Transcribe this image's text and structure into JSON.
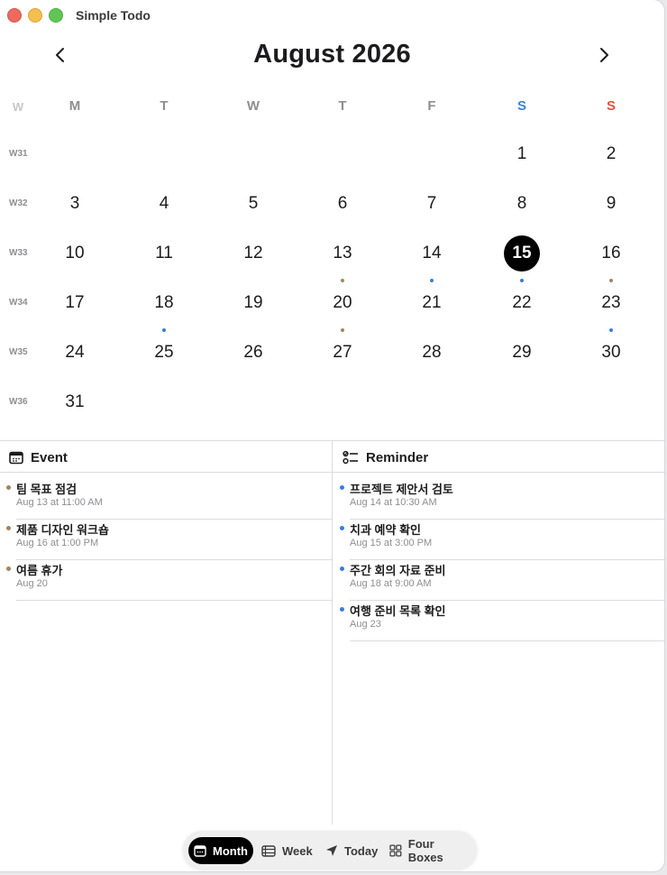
{
  "window": {
    "title": "Simple Todo"
  },
  "calendar": {
    "month_title": "August 2026",
    "weekday_headers": [
      "W",
      "M",
      "T",
      "W",
      "T",
      "F",
      "S",
      "S"
    ],
    "weeks": [
      {
        "label": "W31",
        "days": [
          "",
          "",
          "",
          "",
          "",
          "1",
          "2"
        ]
      },
      {
        "label": "W32",
        "days": [
          "3",
          "4",
          "5",
          "6",
          "7",
          "8",
          "9"
        ]
      },
      {
        "label": "W33",
        "days": [
          "10",
          "11",
          "12",
          "13",
          "14",
          "15",
          "16"
        ]
      },
      {
        "label": "W34",
        "days": [
          "17",
          "18",
          "19",
          "20",
          "21",
          "22",
          "23"
        ]
      },
      {
        "label": "W35",
        "days": [
          "24",
          "25",
          "26",
          "27",
          "28",
          "29",
          "30"
        ]
      },
      {
        "label": "W36",
        "days": [
          "31",
          "",
          "",
          "",
          "",
          "",
          ""
        ]
      }
    ],
    "selected_day": "15",
    "event_days": [
      "13",
      "16",
      "20"
    ],
    "reminder_days": [
      "14",
      "15",
      "18",
      "23"
    ]
  },
  "events": {
    "header": "Event",
    "items": [
      {
        "title": "팀 목표 점검",
        "time": "Aug 13 at 11:00 AM"
      },
      {
        "title": "제품 디자인 워크숍",
        "time": "Aug 16 at 1:00 PM"
      },
      {
        "title": "여름 휴가",
        "time": "Aug 20"
      }
    ]
  },
  "reminders": {
    "header": "Reminder",
    "items": [
      {
        "title": "프로젝트 제안서 검토",
        "time": "Aug 14 at 10:30 AM"
      },
      {
        "title": "치과 예약 확인",
        "time": "Aug 15 at 3:00 PM"
      },
      {
        "title": "주간 회의 자료 준비",
        "time": "Aug 18 at 9:00 AM"
      },
      {
        "title": "여행 준비 목록 확인",
        "time": "Aug 23"
      }
    ]
  },
  "tabs": [
    {
      "label": "Month",
      "icon": "calendar-icon",
      "active": true
    },
    {
      "label": "Week",
      "icon": "week-rows-icon",
      "active": false
    },
    {
      "label": "Today",
      "icon": "location-arrow-icon",
      "active": false
    },
    {
      "label": "Four Boxes",
      "icon": "four-squares-icon",
      "active": false
    }
  ],
  "colors": {
    "event_dot": "#a08560",
    "reminder_dot": "#3b7dd8",
    "saturday": "#3b82d6",
    "sunday": "#e0533d",
    "selected_bg": "#000000"
  }
}
